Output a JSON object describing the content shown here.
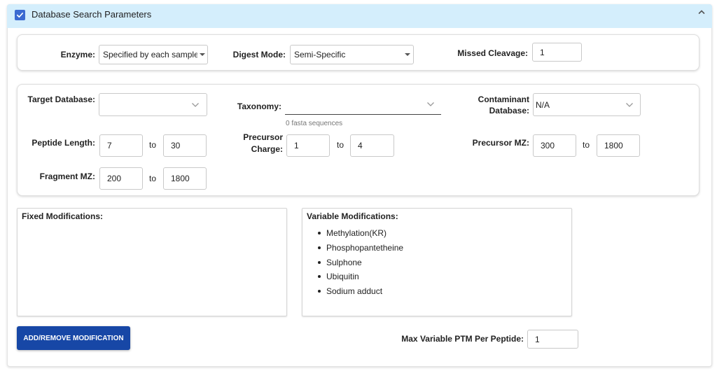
{
  "header": {
    "title": "Database Search Parameters",
    "checkbox_checked": true,
    "accent_color": "#3b6ad1",
    "header_bg": "#d4eefc"
  },
  "digest": {
    "enzyme_label": "Enzyme:",
    "enzyme_value": "Specified by each sample",
    "digest_mode_label": "Digest Mode:",
    "digest_mode_value": "Semi-Specific",
    "missed_cleavage_label": "Missed Cleavage:",
    "missed_cleavage_value": "1"
  },
  "database": {
    "target_db_label": "Target Database:",
    "target_db_value": "",
    "taxonomy_label": "Taxonomy:",
    "taxonomy_value": "",
    "taxonomy_hint": "0 fasta sequences",
    "contaminant_label_line1": "Contaminant",
    "contaminant_label_line2": "Database:",
    "contaminant_value": "N/A",
    "peptide_length_label": "Peptide Length:",
    "peptide_length_min": "7",
    "peptide_length_max": "30",
    "precursor_charge_label_line1": "Precursor",
    "precursor_charge_label_line2": "Charge:",
    "precursor_charge_min": "1",
    "precursor_charge_max": "4",
    "precursor_mz_label": "Precursor MZ:",
    "precursor_mz_min": "300",
    "precursor_mz_max": "1800",
    "fragment_mz_label": "Fragment MZ:",
    "fragment_mz_min": "200",
    "fragment_mz_max": "1800",
    "to_label": "to"
  },
  "modifications": {
    "fixed_title": "Fixed Modifications:",
    "fixed_items": [],
    "variable_title": "Variable Modifications:",
    "variable_items": [
      "Methylation(KR)",
      "Phosphopantetheine",
      "Sulphone",
      "Ubiquitin",
      "Sodium adduct"
    ],
    "add_remove_button": "ADD/REMOVE MODIFICATION",
    "button_color": "#1747a6",
    "max_ptm_label": "Max Variable PTM Per Peptide:",
    "max_ptm_value": "1"
  }
}
